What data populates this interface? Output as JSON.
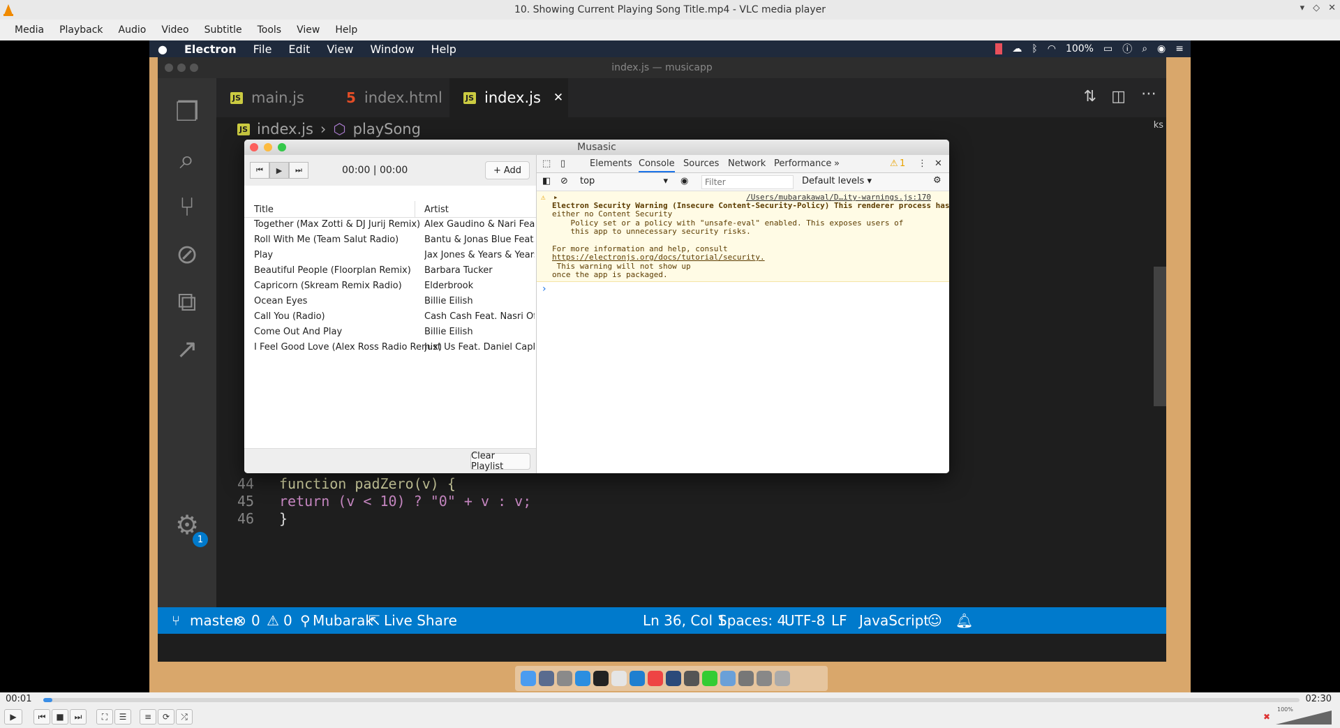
{
  "vlc": {
    "window_title": "10. Showing Current Playing Song Title.mp4 - VLC media player",
    "menu": [
      "Media",
      "Playback",
      "Audio",
      "Video",
      "Subtitle",
      "Tools",
      "View",
      "Help"
    ],
    "elapsed": "00:01",
    "duration": "02:30",
    "progress": 0.007,
    "volume_label": "100%",
    "volume_level": 1.0
  },
  "mac": {
    "menu": [
      "Electron",
      "File",
      "Edit",
      "View",
      "Window",
      "Help"
    ],
    "battery": "100%"
  },
  "vscode": {
    "window_title": "index.js — musicapp",
    "tabs": [
      {
        "label": "main.js",
        "type": "JS"
      },
      {
        "label": "index.html",
        "type": "HTML"
      },
      {
        "label": "index.js",
        "type": "JS"
      }
    ],
    "close_glyph": "✕",
    "breadcrumb": {
      "file": "index.js",
      "symbol": "playSong",
      "sep": "›"
    },
    "side_text": "ks",
    "code": [
      {
        "line": "44",
        "text": "function padZero(v) {"
      },
      {
        "line": "45",
        "text": "return (v < 10) ? \"0\" + v : v;"
      },
      {
        "line": "46",
        "text": "}"
      }
    ],
    "settings_badge": "1",
    "status": {
      "branch": "master",
      "errors": "0",
      "warnings": "0",
      "user": "Mubarak",
      "live_share": "Live Share",
      "position": "Ln 36, Col 1",
      "spaces": "Spaces: 4",
      "encoding": "UTF-8",
      "eol": "LF",
      "language": "JavaScript"
    }
  },
  "electron": {
    "window_title": "Musasic",
    "time": "00:00 | 00:00",
    "add_label": "Add",
    "columns": {
      "title": "Title",
      "artist": "Artist"
    },
    "songs": [
      {
        "title": "Together (Max Zotti & DJ Jurij Remix)",
        "artist": "Alex Gaudino & Nari Feat. Pop"
      },
      {
        "title": "Roll With Me (Team Salut Radio)",
        "artist": "Bantu & Jonas Blue Feat. Shur"
      },
      {
        "title": "Play",
        "artist": "Jax Jones & Years & Years"
      },
      {
        "title": "Beautiful People (Floorplan Remix)",
        "artist": "Barbara Tucker"
      },
      {
        "title": "Capricorn (Skream Remix Radio)",
        "artist": "Elderbrook"
      },
      {
        "title": "Ocean Eyes",
        "artist": "Billie Eilish"
      },
      {
        "title": "Call You (Radio)",
        "artist": "Cash Cash Feat. Nasri Of Mag"
      },
      {
        "title": "Come Out And Play",
        "artist": "Billie Eilish"
      },
      {
        "title": "I Feel Good Love (Alex Ross Radio Remix)",
        "artist": "Just Us Feat. Daniel Caplin"
      }
    ],
    "clear_label": "Clear Playlist"
  },
  "devtools": {
    "tabs": [
      "Elements",
      "Console",
      "Sources",
      "Network",
      "Performance"
    ],
    "more": "»",
    "warn_count": "1",
    "context": "top",
    "filter_placeholder": "Filter",
    "levels": "Default levels ▾",
    "source_link": "/Users/mubarakawal/D…ity-warnings.js:170",
    "warning_lines": [
      "Electron Security Warning (Insecure Content-Security-Policy) This renderer process has",
      "either no Content Security",
      "    Policy set or a policy with \"unsafe-eval\" enabled. This exposes users of",
      "    this app to unnecessary security risks.",
      "",
      "For more information and help, consult",
      "https://electronjs.org/docs/tutorial/security.",
      " This warning will not show up",
      "once the app is packaged."
    ],
    "prompt": "›"
  },
  "colors": {
    "vscode_status": "#007acc",
    "vlc_accent": "#3a8ee6",
    "mac_desktop": "#d9a76b"
  }
}
